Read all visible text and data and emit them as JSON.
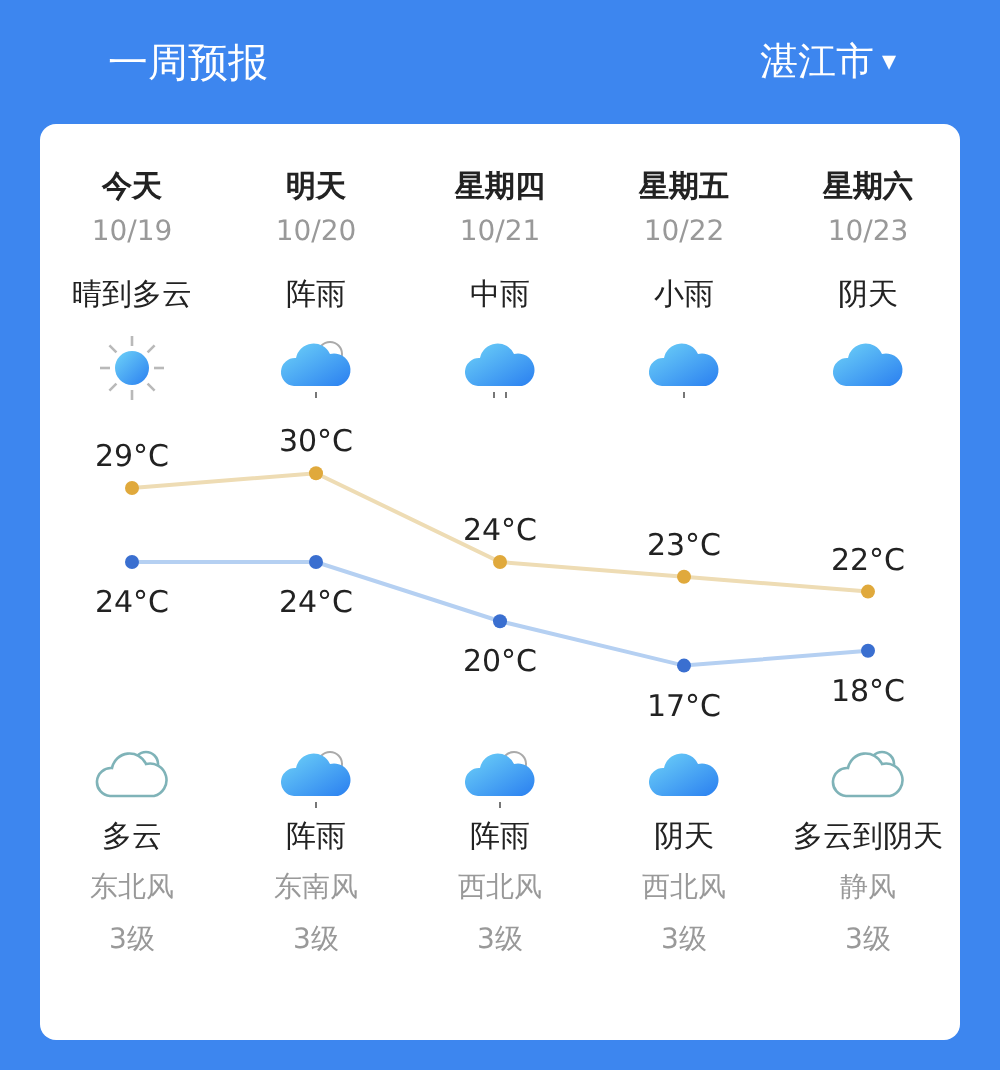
{
  "header": {
    "title": "一周预报",
    "city": "湛江市",
    "caret": "▾"
  },
  "days": [
    {
      "weekday": "今天",
      "date": "10/19",
      "weather": "晴到多云",
      "kind": "sunny"
    },
    {
      "weekday": "明天",
      "date": "10/20",
      "weather": "阵雨",
      "kind": "shower"
    },
    {
      "weekday": "星期四",
      "date": "10/21",
      "weather": "中雨",
      "kind": "rain"
    },
    {
      "weekday": "星期五",
      "date": "10/22",
      "weather": "小雨",
      "kind": "light_rain"
    },
    {
      "weekday": "星期六",
      "date": "10/23",
      "weather": "阴天",
      "kind": "overcast"
    }
  ],
  "chart_data": {
    "type": "line",
    "categories": [
      null,
      null,
      null,
      null,
      null
    ],
    "series": [
      {
        "color": "#eedcb4",
        "marker": "circle",
        "values": [
          29,
          30,
          24,
          23,
          22
        ],
        "value_labels": [
          "29°C",
          "30°C",
          "24°C",
          "23°C",
          "22°C"
        ]
      },
      {
        "color": "#b5d0f2",
        "marker": "circle",
        "values": [
          24,
          24,
          20,
          17,
          18
        ],
        "value_labels": [
          "24°C",
          "24°C",
          "20°C",
          "17°C",
          "18°C"
        ]
      }
    ]
  },
  "nights": [
    {
      "weather": "多云",
      "kind": "partly_cloudy",
      "wind": "东北风",
      "wind_force": "3级"
    },
    {
      "weather": "阵雨",
      "kind": "shower",
      "wind": "东南风",
      "wind_force": "3级"
    },
    {
      "weather": "阵雨",
      "kind": "shower",
      "wind": "西北风",
      "wind_force": "3级"
    },
    {
      "weather": "阴天",
      "kind": "overcast",
      "wind": "西北风",
      "wind_force": "3级"
    },
    {
      "weather": "多云到阴天",
      "kind": "partly_cloudy",
      "wind": "静风",
      "wind_force": "3级"
    }
  ]
}
